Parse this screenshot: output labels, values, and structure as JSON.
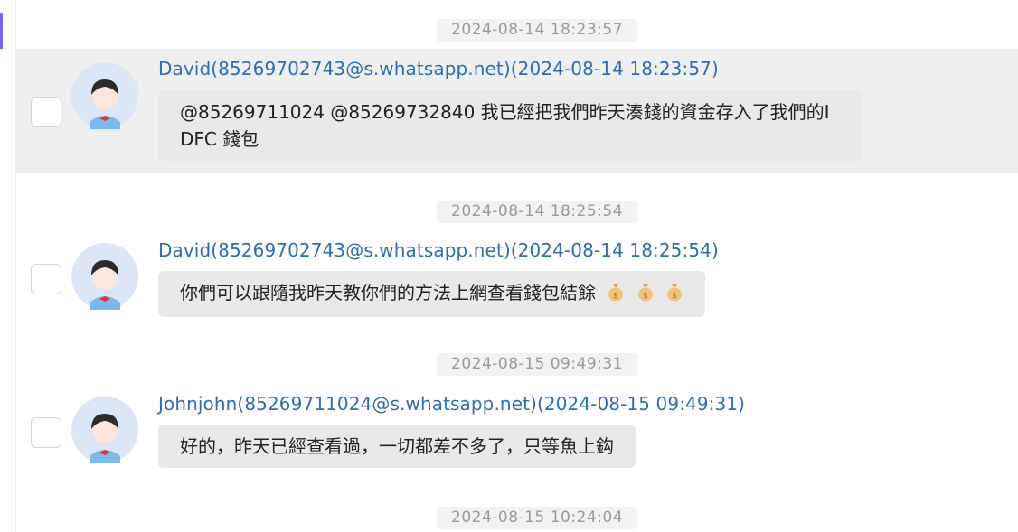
{
  "messages": [
    {
      "timestamp": "2024-08-14 18:23:57",
      "sender": "David(85269702743@s.whatsapp.net)(2024-08-14 18:23:57)",
      "text": "@85269711024 @85269732840 我已經把我們昨天湊錢的資金存入了我們的I\nDFC 錢包",
      "highlighted": true
    },
    {
      "timestamp": "2024-08-14 18:25:54",
      "sender": "David(85269702743@s.whatsapp.net)(2024-08-14 18:25:54)",
      "text": "你們可以跟隨我昨天教你們的方法上網查看錢包結餘",
      "emoji": [
        "money-bag-icon",
        "money-bag-icon",
        "money-bag-icon"
      ]
    },
    {
      "timestamp": "2024-08-15 09:49:31",
      "sender": "Johnjohn(85269711024@s.whatsapp.net)(2024-08-15 09:49:31)",
      "text": "好的，昨天已經查看過，一切都差不多了，只等魚上鈎"
    },
    {
      "timestamp": "2024-08-15 10:24:04"
    }
  ],
  "colors": {
    "sender": "#2f6db5",
    "bubble": "#e9e9e9",
    "highlight_row": "#efefef",
    "timestamp_text": "#9a9a9a",
    "accent": "#7b61ff"
  }
}
